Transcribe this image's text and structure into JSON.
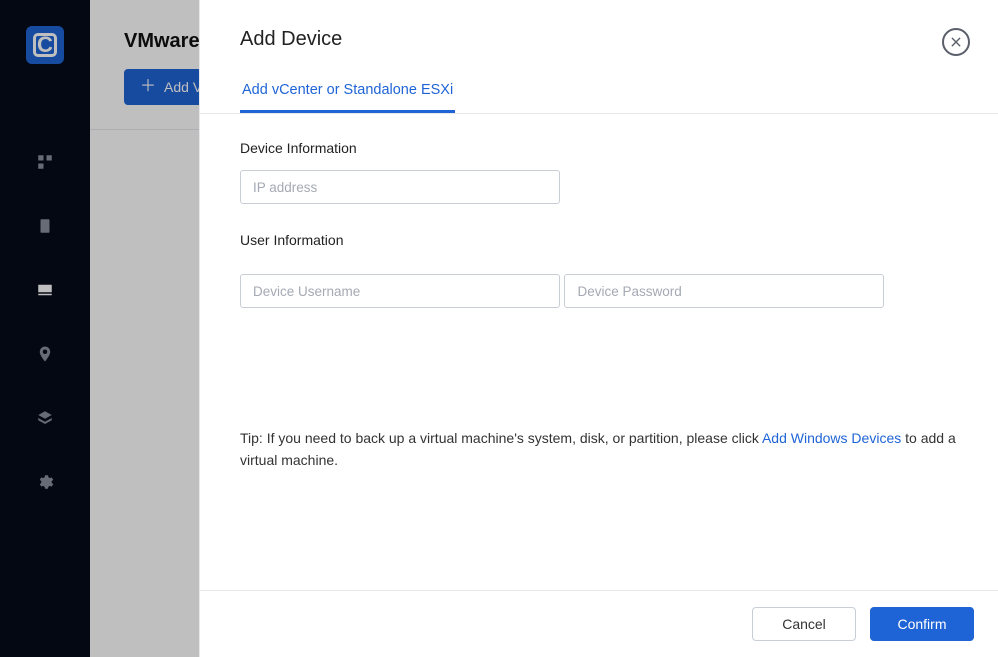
{
  "sidebar": {
    "logo_letter": "C"
  },
  "main": {
    "title": "VMware",
    "add_button_label": "Add VMware ESXi"
  },
  "modal": {
    "title": "Add Device",
    "tab_label": "Add vCenter or Standalone ESXi",
    "device_info_label": "Device Information",
    "ip_placeholder": "IP address",
    "user_info_label": "User Information",
    "username_placeholder": "Device Username",
    "password_placeholder": "Device Password",
    "tip_prefix": "Tip: If you need to back up a virtual machine's system, disk, or partition, please click ",
    "tip_link": "Add Windows Devices",
    "tip_suffix": " to add a virtual machine.",
    "cancel_label": "Cancel",
    "confirm_label": "Confirm"
  }
}
